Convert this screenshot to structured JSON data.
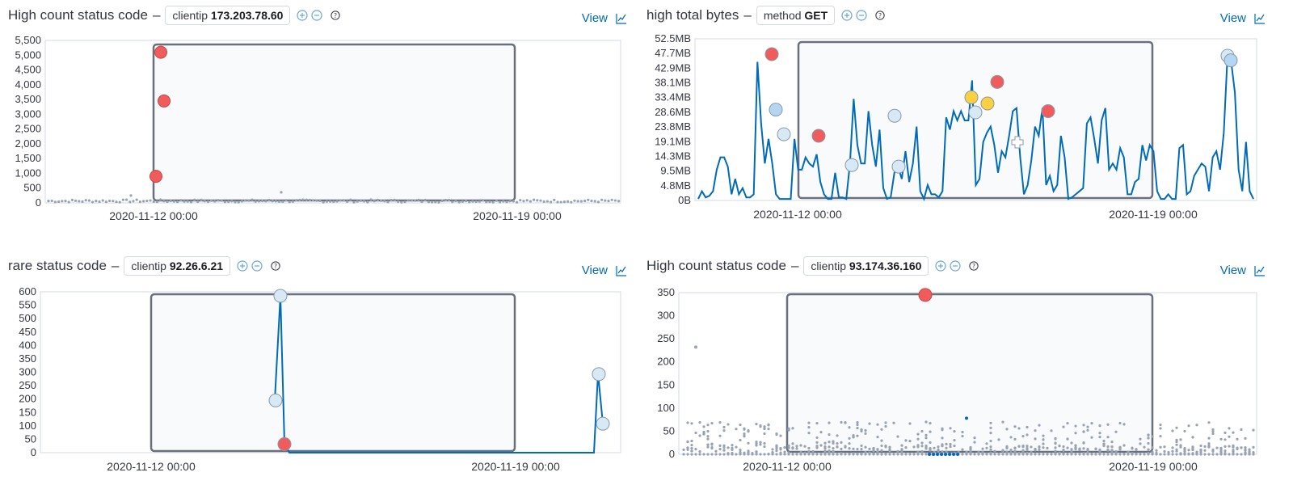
{
  "view_label": "View",
  "panels": [
    {
      "title": "High count status code",
      "filter_key": "clientip",
      "filter_value": "173.203.78.60",
      "chart_data": {
        "type": "scatter",
        "y_ticks": [
          "5,500",
          "5,000",
          "4,500",
          "4,000",
          "3,500",
          "3,000",
          "2,500",
          "2,000",
          "1,500",
          "1,000",
          "500",
          "0"
        ],
        "ylim": [
          0,
          5500
        ],
        "x_ticks": [
          "2020-11-12 00:00",
          "2020-11-19 00:00"
        ],
        "anomalies": [
          {
            "y": 5100,
            "severity": "critical"
          },
          {
            "y": 3450,
            "severity": "critical"
          },
          {
            "y": 900,
            "severity": "critical"
          }
        ]
      }
    },
    {
      "title": "high total bytes",
      "filter_key": "method",
      "filter_value": "GET",
      "chart_data": {
        "type": "line",
        "y_ticks": [
          "52.5MB",
          "47.7MB",
          "42.9MB",
          "38.1MB",
          "33.4MB",
          "28.6MB",
          "23.8MB",
          "19.1MB",
          "14.3MB",
          "9.5MB",
          "4.8MB",
          "0B"
        ],
        "ylim": [
          0,
          52.5
        ],
        "x_ticks": [
          "2020-11-12 00:00",
          "2020-11-19 00:00"
        ]
      }
    },
    {
      "title": "rare status code",
      "filter_key": "clientip",
      "filter_value": "92.26.6.21",
      "chart_data": {
        "type": "line",
        "y_ticks": [
          "600",
          "550",
          "500",
          "450",
          "400",
          "350",
          "300",
          "250",
          "200",
          "150",
          "100",
          "50",
          "0"
        ],
        "ylim": [
          0,
          600
        ],
        "x_ticks": [
          "2020-11-12 00:00",
          "2020-11-19 00:00"
        ]
      }
    },
    {
      "title": "High count status code",
      "filter_key": "clientip",
      "filter_value": "93.174.36.160",
      "chart_data": {
        "type": "scatter",
        "y_ticks": [
          "350",
          "300",
          "250",
          "200",
          "150",
          "100",
          "50",
          "0"
        ],
        "ylim": [
          0,
          350
        ],
        "x_ticks": [
          "2020-11-12 00:00",
          "2020-11-19 00:00"
        ],
        "anomalies": [
          {
            "y": 345,
            "severity": "critical"
          }
        ]
      }
    }
  ],
  "colors": {
    "line": "#006bb8",
    "critical": "#f05c5c",
    "major": "#fbd13f",
    "minor": "#b3d6f2",
    "low": "#d6e9f5",
    "dot": "#98a2b3",
    "link": "#006bb8"
  }
}
